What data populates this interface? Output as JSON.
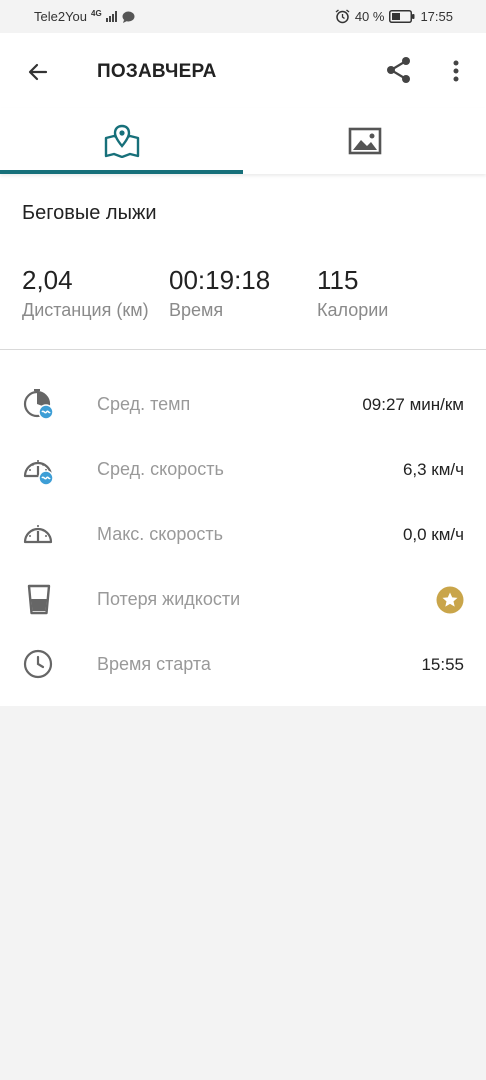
{
  "status_bar": {
    "carrier": "Tele2You",
    "network": "4G",
    "battery_percent": "40 %",
    "time": "17:55"
  },
  "header": {
    "title": "ПОЗАВЧЕРА"
  },
  "tabs": [
    {
      "icon": "map-icon",
      "active": true
    },
    {
      "icon": "image-icon",
      "active": false
    }
  ],
  "activity": {
    "sport": "Беговые лыжи",
    "summary": [
      {
        "value": "2,04",
        "label": "Дистанция (км)"
      },
      {
        "value": "00:19:18",
        "label": "Время"
      },
      {
        "value": "115",
        "label": "Калории"
      }
    ],
    "details": [
      {
        "icon": "pace-icon",
        "label": "Сред. темп",
        "value": "09:27 мин/км"
      },
      {
        "icon": "speedometer-avg-icon",
        "label": "Сред. скорость",
        "value": "6,3 км/ч"
      },
      {
        "icon": "speedometer-icon",
        "label": "Макс. скорость",
        "value": "0,0 км/ч"
      },
      {
        "icon": "cup-icon",
        "label": "Потеря жидкости",
        "value": ""
      },
      {
        "icon": "clock-icon",
        "label": "Время старта",
        "value": "15:55"
      }
    ]
  },
  "colors": {
    "accent": "#17707a",
    "gold": "#c9a54a",
    "badge_blue": "#3d9ed6"
  }
}
